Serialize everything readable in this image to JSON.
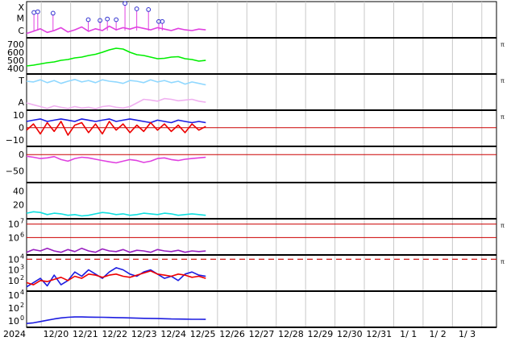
{
  "chart_data": {
    "type": "line",
    "x_start": "2024-12-19",
    "x_end": "2025-01-04",
    "visible_x_end_index": 5.6,
    "x_ticks": [
      "2024",
      "12/20",
      "12/21",
      "12/22",
      "12/23",
      "12/24",
      "12/25",
      "12/26",
      "12/27",
      "12/28",
      "12/29",
      "12/30",
      "12/31",
      "1/ 1",
      "1/ 2",
      "1/ 3"
    ],
    "panels": [
      {
        "id": "xray",
        "yticks": [
          {
            "text": "X",
            "v": 0.85
          },
          {
            "text": "M",
            "v": 0.55
          },
          {
            "text": "C",
            "v": 0.2
          }
        ],
        "ylim": [
          0,
          1
        ],
        "series": [
          {
            "color": "#e040e0",
            "kind": "flare-flux",
            "values": [
              0.12,
              0.18,
              0.25,
              0.15,
              0.2,
              0.28,
              0.16,
              0.22,
              0.3,
              0.18,
              0.25,
              0.2,
              0.32,
              0.22,
              0.28,
              0.24,
              0.3,
              0.26,
              0.22,
              0.28,
              0.24,
              0.2,
              0.26,
              0.22,
              0.2,
              0.24,
              0.22
            ]
          }
        ],
        "events": [
          {
            "t": 0.25,
            "v": 0.7
          },
          {
            "t": 0.38,
            "v": 0.72
          },
          {
            "t": 0.9,
            "v": 0.68
          },
          {
            "t": 2.1,
            "v": 0.5
          },
          {
            "t": 2.5,
            "v": 0.48
          },
          {
            "t": 2.75,
            "v": 0.52
          },
          {
            "t": 3.05,
            "v": 0.5
          },
          {
            "t": 3.35,
            "v": 0.95
          },
          {
            "t": 3.75,
            "v": 0.8
          },
          {
            "t": 4.15,
            "v": 0.78
          },
          {
            "t": 4.5,
            "v": 0.45
          },
          {
            "t": 4.62,
            "v": 0.45
          }
        ]
      },
      {
        "id": "solar-wind-speed",
        "yticks": [
          {
            "text": "700",
            "v": 700
          },
          {
            "text": "600",
            "v": 600
          },
          {
            "text": "500",
            "v": 500
          },
          {
            "text": "400",
            "v": 400
          }
        ],
        "ylim": [
          330,
          780
        ],
        "marker": "π",
        "series": [
          {
            "color": "#00ee00",
            "values": [
              430,
              440,
              455,
              470,
              480,
              500,
              510,
              530,
              540,
              560,
              575,
              600,
              630,
              650,
              640,
              600,
              570,
              560,
              540,
              520,
              525,
              540,
              545,
              520,
              510,
              490,
              500
            ]
          }
        ]
      },
      {
        "id": "temperature-alpha",
        "yticks": [
          {
            "text": "T",
            "v": 0.82
          },
          {
            "text": "A",
            "v": 0.22
          }
        ],
        "ylim": [
          0,
          1
        ],
        "marker": "π",
        "series": [
          {
            "color": "#90d8ff",
            "values": [
              0.8,
              0.78,
              0.84,
              0.76,
              0.82,
              0.74,
              0.8,
              0.85,
              0.78,
              0.82,
              0.76,
              0.84,
              0.8,
              0.78,
              0.74,
              0.82,
              0.8,
              0.76,
              0.84,
              0.78,
              0.82,
              0.76,
              0.8,
              0.72,
              0.78,
              0.74,
              0.7
            ]
          },
          {
            "color": "#f0b0f0",
            "values": [
              0.2,
              0.15,
              0.1,
              0.05,
              0.12,
              0.08,
              0.05,
              0.1,
              0.06,
              0.08,
              0.04,
              0.1,
              0.12,
              0.08,
              0.06,
              0.1,
              0.2,
              0.3,
              0.28,
              0.25,
              0.32,
              0.3,
              0.26,
              0.28,
              0.3,
              0.25,
              0.22
            ]
          }
        ]
      },
      {
        "id": "imf-bz",
        "yticks": [
          {
            "text": "10",
            "v": 10
          },
          {
            "text": "0",
            "v": 0
          },
          {
            "text": "−10",
            "v": -10
          }
        ],
        "ylim": [
          -15,
          14
        ],
        "marker": "π",
        "ref_line": 0,
        "series": [
          {
            "color": "#1c1ce0",
            "values": [
              5,
              6,
              7,
              5,
              6,
              7,
              6,
              5,
              7,
              6,
              5,
              6,
              7,
              5,
              6,
              7,
              6,
              5,
              4,
              6,
              5,
              4,
              6,
              5,
              4,
              5,
              4
            ]
          },
          {
            "color": "#ee0000",
            "values": [
              -2,
              3,
              -5,
              4,
              -3,
              5,
              -6,
              2,
              4,
              -4,
              3,
              -5,
              5,
              -2,
              3,
              -4,
              2,
              -3,
              4,
              -2,
              3,
              -3,
              2,
              -4,
              3,
              -2,
              1
            ]
          }
        ]
      },
      {
        "id": "dst",
        "yticks": [
          {
            "text": "0",
            "v": 0
          },
          {
            "text": "−50",
            "v": -50
          }
        ],
        "ylim": [
          -85,
          25
        ],
        "ref_line": 0,
        "series": [
          {
            "color": "#e040e0",
            "values": [
              -5,
              -8,
              -12,
              -10,
              -6,
              -15,
              -20,
              -12,
              -8,
              -10,
              -14,
              -18,
              -22,
              -25,
              -20,
              -15,
              -18,
              -24,
              -20,
              -12,
              -10,
              -15,
              -18,
              -14,
              -12,
              -10,
              -8
            ]
          }
        ]
      },
      {
        "id": "density",
        "yticks": [
          {
            "text": "40",
            "v": 40
          },
          {
            "text": "20",
            "v": 20
          }
        ],
        "ylim": [
          0,
          52
        ],
        "series": [
          {
            "color": "#10e0e0",
            "values": [
              8,
              10,
              9,
              6,
              8,
              7,
              5,
              6,
              4,
              5,
              7,
              9,
              8,
              6,
              7,
              5,
              6,
              8,
              7,
              6,
              8,
              7,
              5,
              6,
              7,
              6,
              5
            ]
          }
        ]
      },
      {
        "id": "electron-flux",
        "yticks": [
          {
            "text": "10",
            "exp": "7",
            "v": 7
          },
          {
            "text": "10",
            "exp": "6",
            "v": 6
          }
        ],
        "ylim": [
          4.7,
          7.4
        ],
        "marker": "π",
        "ref_lines": [
          7,
          6
        ],
        "series": [
          {
            "color": "#9a20c0",
            "values": [
              4.9,
              5.1,
              5.0,
              5.2,
              5.0,
              4.9,
              5.1,
              4.95,
              5.2,
              5.0,
              4.9,
              5.15,
              5.0,
              4.95,
              5.1,
              4.9,
              5.05,
              5.0,
              4.9,
              5.1,
              5.0,
              4.95,
              5.05,
              4.9,
              5.0,
              4.95,
              5.0
            ]
          }
        ]
      },
      {
        "id": "proton-flux",
        "yticks": [
          {
            "text": "10",
            "exp": "4",
            "v": 4
          },
          {
            "text": "10",
            "exp": "3",
            "v": 3
          },
          {
            "text": "10",
            "exp": "2",
            "v": 2
          }
        ],
        "ylim": [
          1.0,
          4.4
        ],
        "marker": "π",
        "dashed_ref": 4,
        "series": [
          {
            "color": "#1c1ce0",
            "values": [
              1.4,
              1.8,
              2.2,
              1.5,
              2.5,
              1.6,
              2.0,
              2.8,
              2.4,
              3.0,
              2.6,
              2.2,
              2.8,
              3.2,
              3.0,
              2.6,
              2.4,
              2.8,
              3.0,
              2.6,
              2.2,
              2.4,
              2.0,
              2.6,
              2.8,
              2.5,
              2.4
            ]
          },
          {
            "color": "#ee0000",
            "values": [
              1.8,
              1.6,
              2.0,
              1.9,
              2.1,
              2.3,
              2.0,
              2.4,
              2.2,
              2.6,
              2.5,
              2.3,
              2.5,
              2.6,
              2.4,
              2.3,
              2.5,
              2.7,
              2.9,
              2.6,
              2.5,
              2.4,
              2.6,
              2.5,
              2.3,
              2.4,
              2.2
            ]
          }
        ]
      },
      {
        "id": "neutron",
        "yticks": [
          {
            "text": "10",
            "exp": "4",
            "v": 4
          },
          {
            "text": "10",
            "exp": "2",
            "v": 2
          },
          {
            "text": "10",
            "exp": "0",
            "v": 0
          }
        ],
        "ylim": [
          -1.0,
          4.6
        ],
        "series": [
          {
            "color": "#1c1ce0",
            "values": [
              -0.4,
              -0.3,
              -0.1,
              0.1,
              0.3,
              0.45,
              0.55,
              0.6,
              0.6,
              0.58,
              0.57,
              0.55,
              0.53,
              0.5,
              0.48,
              0.45,
              0.42,
              0.4,
              0.38,
              0.36,
              0.33,
              0.3,
              0.28,
              0.27,
              0.25,
              0.24,
              0.23
            ]
          }
        ]
      }
    ]
  }
}
